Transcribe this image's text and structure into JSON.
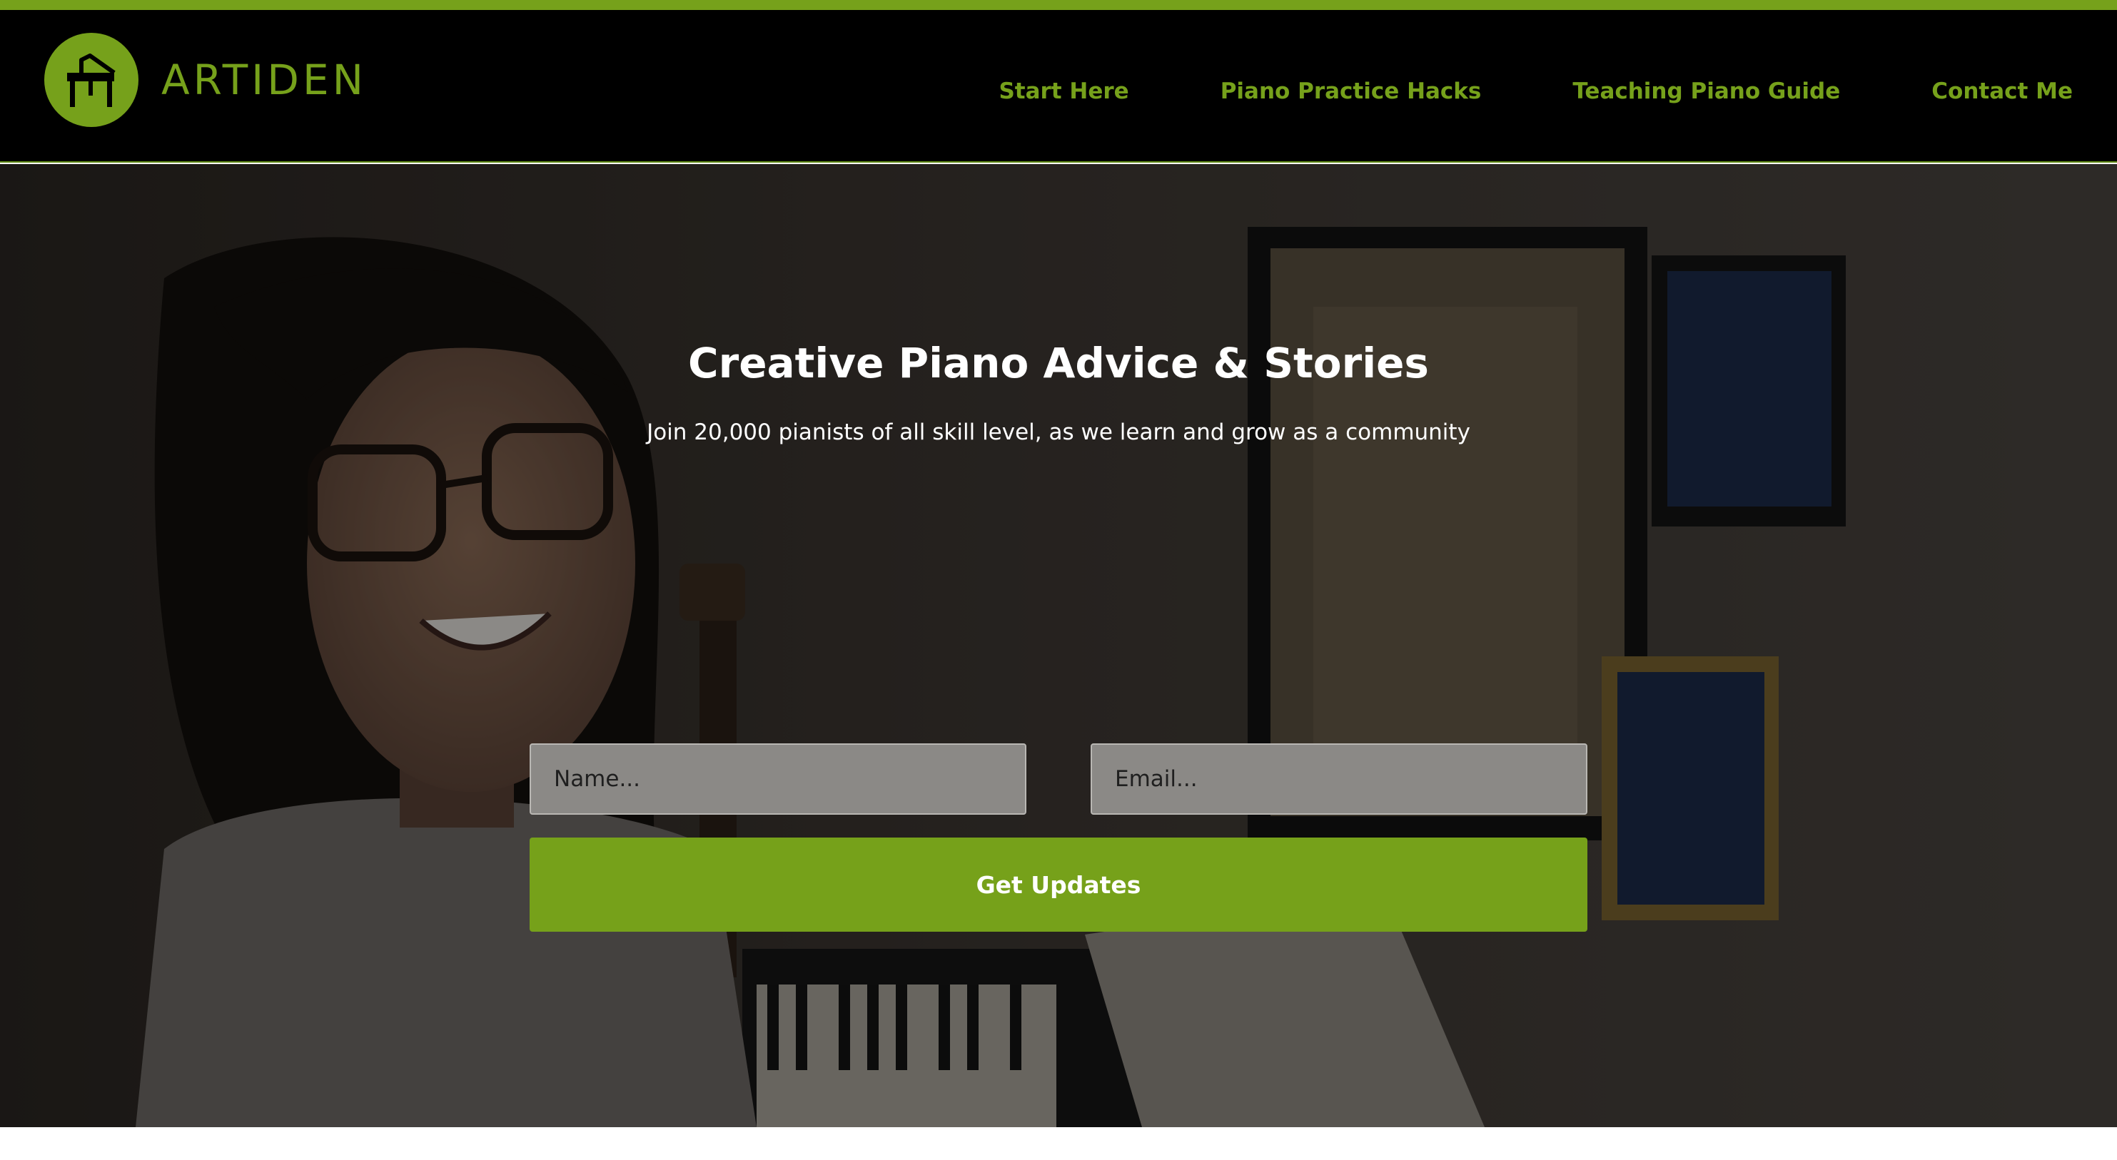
{
  "brand": {
    "name": "ARTIDEN",
    "logo_icon": "grand-piano-icon",
    "accent_color": "#76a11b"
  },
  "nav": {
    "items": [
      {
        "label": "Start Here"
      },
      {
        "label": "Piano Practice Hacks"
      },
      {
        "label": "Teaching Piano Guide"
      },
      {
        "label": "Contact Me"
      }
    ]
  },
  "hero": {
    "title": "Creative Piano Advice & Stories",
    "subtitle": "Join 20,000 pianists of all skill level, as we learn and grow as a community",
    "form": {
      "name_placeholder": "Name...",
      "email_placeholder": "Email...",
      "submit_label": "Get Updates"
    }
  }
}
